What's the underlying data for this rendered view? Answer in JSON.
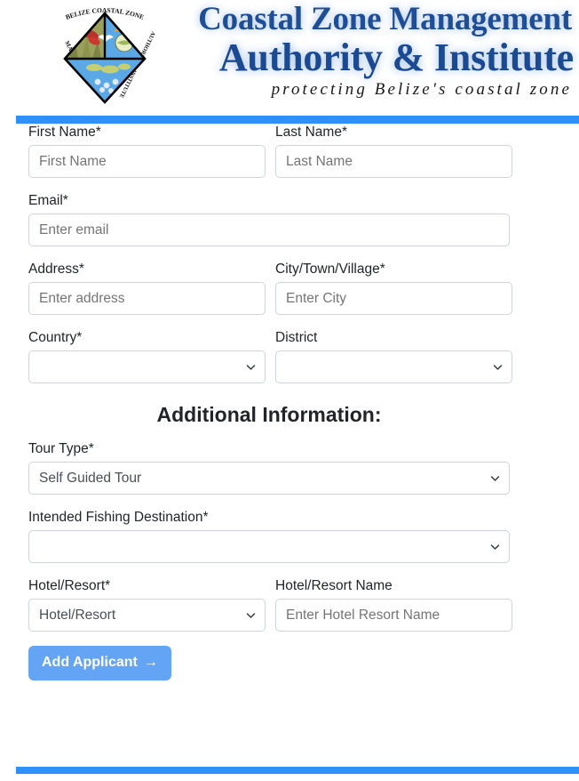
{
  "header": {
    "logo_alt": "Belize Coastal Zone Management Authority and Institute seal",
    "logo_ring_top": "BELIZE COASTAL ZONE",
    "logo_ring_left": "MANAGEMENT",
    "logo_ring_right": "AUTHORITY & INSTITUTE",
    "title_line1": "Coastal Zone Management",
    "title_line2": "Authority & Institute",
    "tagline": "protecting Belize's coastal zone"
  },
  "theme": {
    "rule_color": "#2f90fa",
    "button_color": "#63a4f5",
    "title_color": "#1f4e96",
    "border_color": "#ced4da",
    "placeholder_color": "#9aa0a6"
  },
  "form": {
    "first_name": {
      "label": "First Name*",
      "value": "",
      "placeholder": "First Name"
    },
    "last_name": {
      "label": "Last Name*",
      "value": "",
      "placeholder": "Last Name"
    },
    "email": {
      "label": "Email*",
      "value": "",
      "placeholder": "Enter email"
    },
    "address": {
      "label": "Address*",
      "value": "",
      "placeholder": "Enter address"
    },
    "city": {
      "label": "City/Town/Village*",
      "value": "",
      "placeholder": "Enter City"
    },
    "country": {
      "label": "Country*",
      "value": ""
    },
    "district": {
      "label": "District",
      "value": ""
    },
    "section_heading": "Additional Information:",
    "tour_type": {
      "label": "Tour Type*",
      "value": "Self Guided Tour"
    },
    "fishing_destination": {
      "label": "Intended Fishing Destination*",
      "value": ""
    },
    "hotel_resort": {
      "label": "Hotel/Resort*",
      "value": "Hotel/Resort"
    },
    "hotel_resort_name": {
      "label": "Hotel/Resort Name",
      "value": "",
      "placeholder": "Enter Hotel Resort Name"
    },
    "submit": {
      "label": "Add Applicant",
      "arrow": "→"
    }
  }
}
